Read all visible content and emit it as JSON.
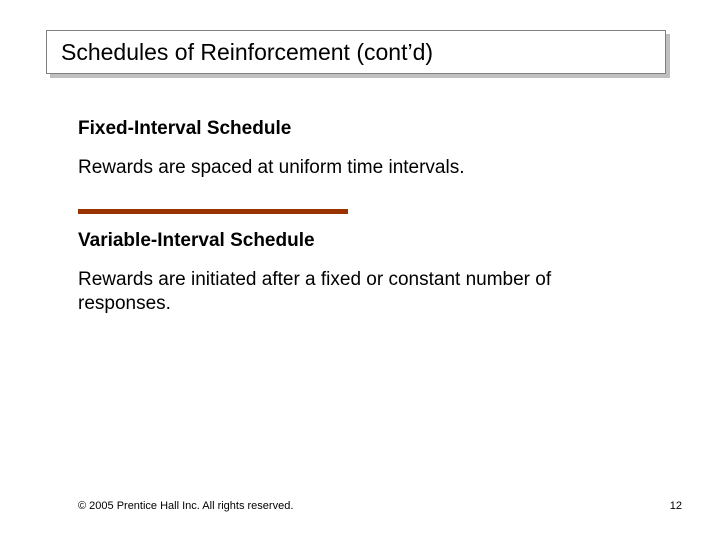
{
  "title": "Schedules of Reinforcement (cont’d)",
  "section1": {
    "heading": "Fixed-Interval Schedule",
    "body": "Rewards are spaced at uniform time intervals."
  },
  "section2": {
    "heading": "Variable-Interval Schedule",
    "body": "Rewards are initiated after a fixed or constant number of responses."
  },
  "footer": {
    "copyright": "© 2005 Prentice Hall Inc. All rights reserved.",
    "page": "12"
  },
  "colors": {
    "divider": "#993300"
  }
}
